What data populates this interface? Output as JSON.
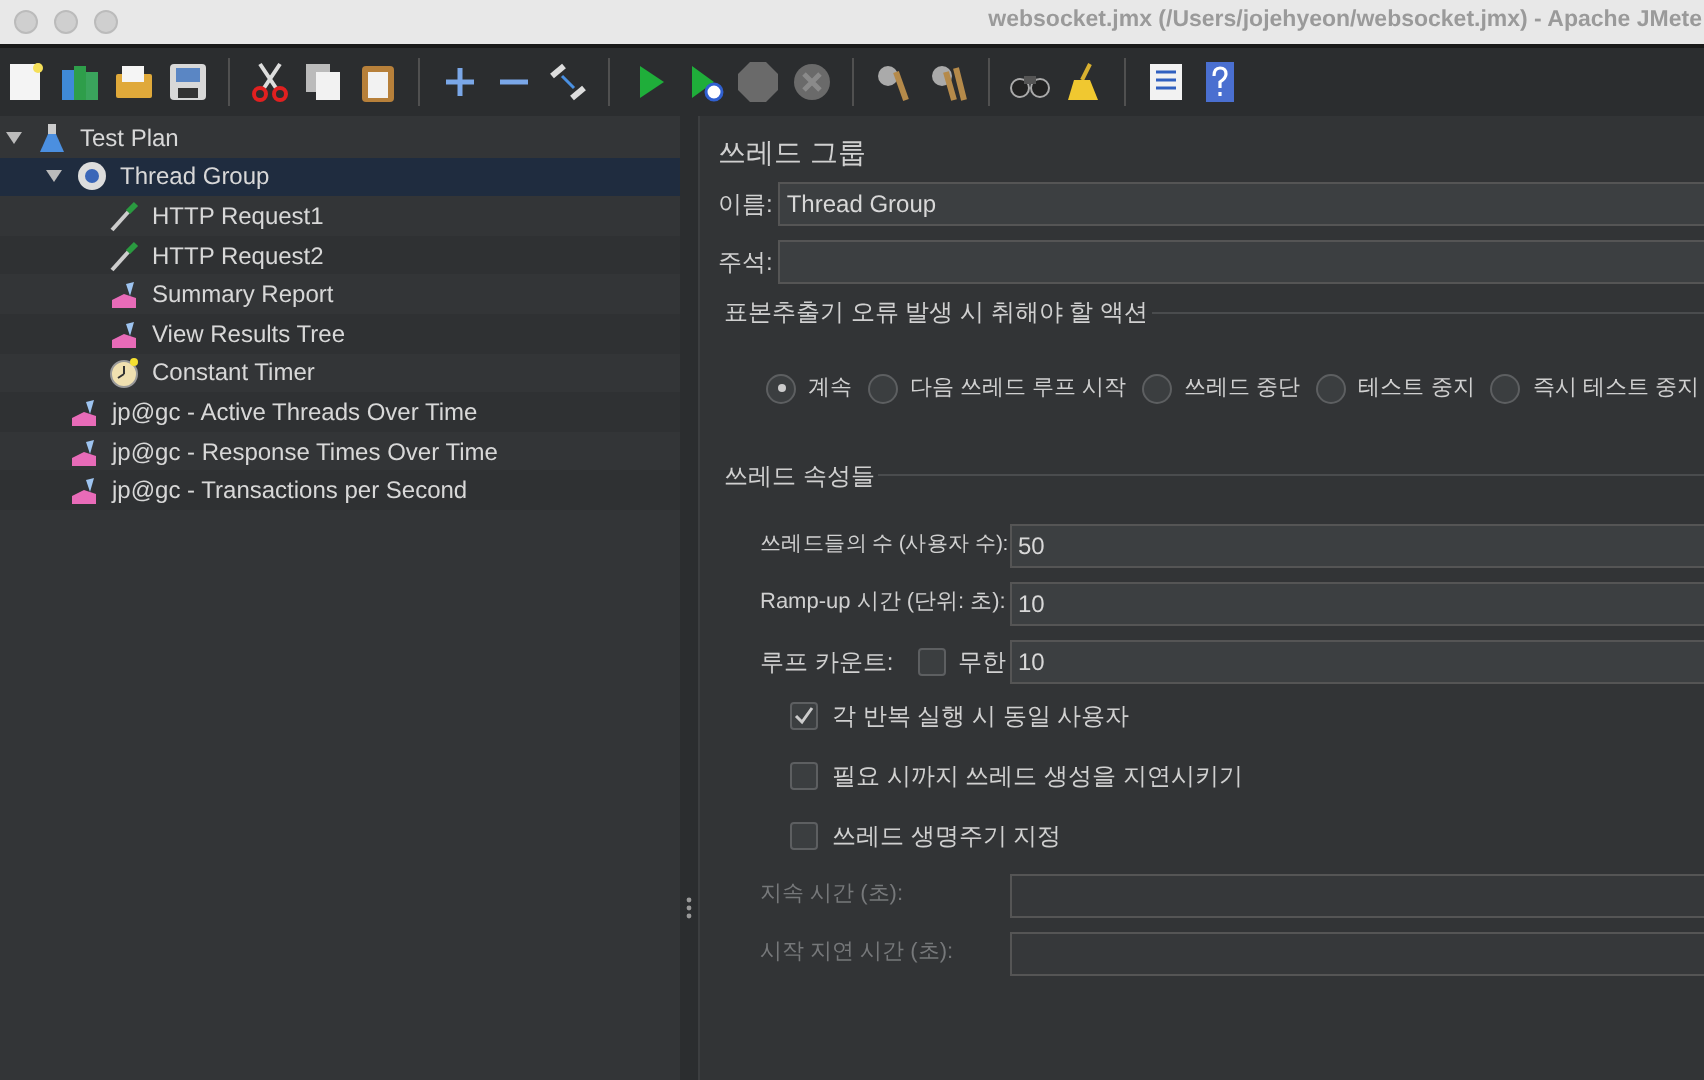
{
  "window": {
    "title": "websocket.jmx (/Users/jojehyeon/websocket.jmx) - Apache JMete"
  },
  "toolbar": [
    {
      "kind": "new"
    },
    {
      "kind": "templates"
    },
    {
      "kind": "open"
    },
    {
      "kind": "save"
    },
    {
      "kind": "sep"
    },
    {
      "kind": "cut"
    },
    {
      "kind": "copy"
    },
    {
      "kind": "paste"
    },
    {
      "kind": "sep"
    },
    {
      "kind": "expand"
    },
    {
      "kind": "collapse"
    },
    {
      "kind": "toggle"
    },
    {
      "kind": "sep"
    },
    {
      "kind": "start"
    },
    {
      "kind": "start-no-timers"
    },
    {
      "kind": "stop",
      "disabled": true
    },
    {
      "kind": "shutdown",
      "disabled": true
    },
    {
      "kind": "sep"
    },
    {
      "kind": "clear"
    },
    {
      "kind": "clear-all"
    },
    {
      "kind": "sep"
    },
    {
      "kind": "search"
    },
    {
      "kind": "reset"
    },
    {
      "kind": "sep"
    },
    {
      "kind": "functions"
    },
    {
      "kind": "help"
    }
  ],
  "tree": [
    {
      "label": "Test Plan",
      "kind": "plan",
      "expanded": true,
      "selected": false,
      "children": [
        {
          "label": "Thread Group",
          "kind": "thread-group",
          "expanded": true,
          "selected": true,
          "children": [
            {
              "label": "HTTP Request1",
              "kind": "sampler",
              "selected": false
            },
            {
              "label": "HTTP Request2",
              "kind": "sampler",
              "selected": false
            },
            {
              "label": "Summary Report",
              "kind": "listener",
              "selected": false
            },
            {
              "label": "View Results Tree",
              "kind": "listener",
              "selected": false
            },
            {
              "label": "Constant Timer",
              "kind": "timer",
              "selected": false
            }
          ]
        },
        {
          "label": "jp@gc - Active Threads Over Time",
          "kind": "listener",
          "selected": false
        },
        {
          "label": "jp@gc - Response Times Over Time",
          "kind": "listener",
          "selected": false
        },
        {
          "label": "jp@gc - Transactions per Second",
          "kind": "listener",
          "selected": false
        }
      ]
    }
  ],
  "panel": {
    "title": "쓰레드 그룹",
    "name": {
      "label": "이름:",
      "value": "Thread Group"
    },
    "comment": {
      "label": "주석:"
    },
    "error_action": {
      "title": "표본추출기 오류 발생 시 취해야 할 액션",
      "options": [
        {
          "label": "계속",
          "selected": true
        },
        {
          "label": "다음 쓰레드 루프 시작",
          "selected": false
        },
        {
          "label": "쓰레드 중단",
          "selected": false
        },
        {
          "label": "테스트 중지",
          "selected": false
        },
        {
          "label": "즉시 테스트 중지",
          "selected": false
        }
      ]
    },
    "properties": {
      "title": "쓰레드 속성들",
      "threads": {
        "label": "쓰레드들의 수 (사용자 수):",
        "value": "50"
      },
      "ramp_up": {
        "label": "Ramp-up 시간 (단위: 초):",
        "value": "10"
      },
      "loop": {
        "label": "루프 카운트:",
        "infinite_label": "무한",
        "infinite": false,
        "value": "10"
      },
      "checkboxes": [
        {
          "label": "각 반복 실행 시 동일 사용자",
          "checked": true
        },
        {
          "label": "필요 시까지 쓰레드 생성을 지연시키기",
          "checked": false
        },
        {
          "label": "쓰레드 생명주기 지정",
          "checked": false
        }
      ],
      "duration": {
        "label": "지속 시간 (초):",
        "disabled": true
      },
      "delay": {
        "label": "시작 지연 시간 (초):",
        "disabled": true
      }
    }
  }
}
